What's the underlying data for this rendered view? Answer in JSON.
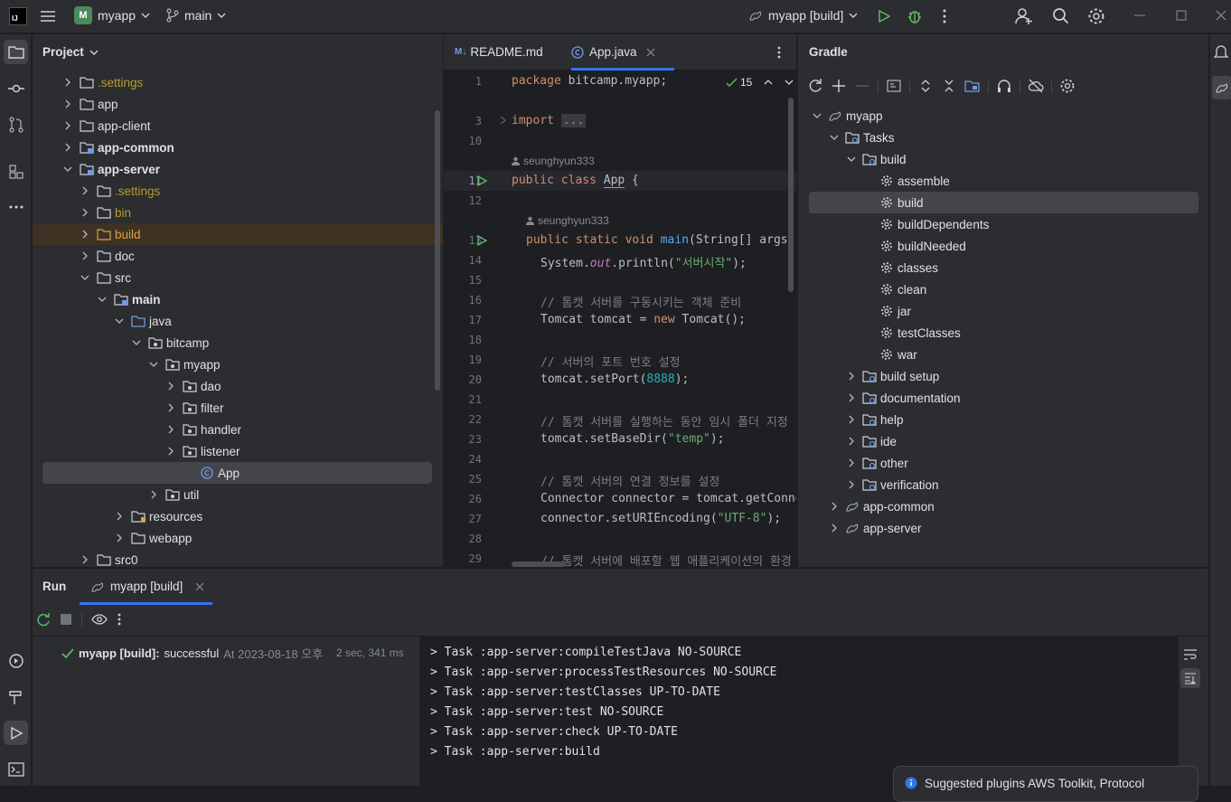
{
  "titlebar": {
    "project_badge": "M",
    "project_name": "myapp",
    "branch": "main",
    "run_config": "myapp [build]"
  },
  "project": {
    "title": "Project",
    "items": [
      {
        "label": ".settings",
        "depth": 1,
        "color": "#b89c2e",
        "icon": "folder"
      },
      {
        "label": "app",
        "depth": 1,
        "color": "#dfe1e5",
        "icon": "folder"
      },
      {
        "label": "app-client",
        "depth": 1,
        "color": "#dfe1e5",
        "icon": "folder"
      },
      {
        "label": "app-common",
        "depth": 1,
        "color": "#dfe1e5",
        "icon": "module",
        "bold": true
      },
      {
        "label": "app-server",
        "depth": 1,
        "color": "#dfe1e5",
        "icon": "module",
        "bold": true,
        "open": true
      },
      {
        "label": ".settings",
        "depth": 2,
        "color": "#b89c2e",
        "icon": "folder"
      },
      {
        "label": "bin",
        "depth": 2,
        "color": "#b89c2e",
        "icon": "folder"
      },
      {
        "label": "build",
        "depth": 2,
        "color": "#d9a343",
        "icon": "folder-orange",
        "highlight": true
      },
      {
        "label": "doc",
        "depth": 2,
        "color": "#dfe1e5",
        "icon": "folder"
      },
      {
        "label": "src",
        "depth": 2,
        "color": "#dfe1e5",
        "icon": "folder",
        "open": true
      },
      {
        "label": "main",
        "depth": 3,
        "color": "#dfe1e5",
        "icon": "module",
        "bold": true,
        "open": true
      },
      {
        "label": "java",
        "depth": 4,
        "color": "#dfe1e5",
        "icon": "folder-blue",
        "open": true
      },
      {
        "label": "bitcamp",
        "depth": 5,
        "color": "#dfe1e5",
        "icon": "package",
        "open": true
      },
      {
        "label": "myapp",
        "depth": 6,
        "color": "#dfe1e5",
        "icon": "package",
        "open": true
      },
      {
        "label": "dao",
        "depth": 7,
        "color": "#dfe1e5",
        "icon": "package"
      },
      {
        "label": "filter",
        "depth": 7,
        "color": "#dfe1e5",
        "icon": "package"
      },
      {
        "label": "handler",
        "depth": 7,
        "color": "#dfe1e5",
        "icon": "package"
      },
      {
        "label": "listener",
        "depth": 7,
        "color": "#dfe1e5",
        "icon": "package"
      },
      {
        "label": "App",
        "depth": 8,
        "color": "#dfe1e5",
        "icon": "class",
        "selected": true,
        "leaf": true
      },
      {
        "label": "util",
        "depth": 6,
        "color": "#dfe1e5",
        "icon": "package"
      },
      {
        "label": "resources",
        "depth": 4,
        "color": "#dfe1e5",
        "icon": "folder-res"
      },
      {
        "label": "webapp",
        "depth": 4,
        "color": "#dfe1e5",
        "icon": "folder"
      },
      {
        "label": "src0",
        "depth": 2,
        "color": "#dfe1e5",
        "icon": "folder"
      }
    ]
  },
  "editor": {
    "tabs": [
      {
        "label": "README.md",
        "badge": "M↓"
      },
      {
        "label": "App.java",
        "active": true
      }
    ],
    "inspection_count": "15",
    "author1": "seunghyun333",
    "author2": "seunghyun333"
  },
  "gradle": {
    "title": "Gradle",
    "items": [
      {
        "label": "myapp",
        "depth": 0,
        "icon": "gradle",
        "arrow": "open"
      },
      {
        "label": "Tasks",
        "depth": 1,
        "icon": "folder-tasks",
        "arrow": "open"
      },
      {
        "label": "build",
        "depth": 2,
        "icon": "folder-tasks",
        "arrow": "open"
      },
      {
        "label": "assemble",
        "depth": 3,
        "icon": "gear"
      },
      {
        "label": "build",
        "depth": 3,
        "icon": "gear",
        "selected": true
      },
      {
        "label": "buildDependents",
        "depth": 3,
        "icon": "gear"
      },
      {
        "label": "buildNeeded",
        "depth": 3,
        "icon": "gear"
      },
      {
        "label": "classes",
        "depth": 3,
        "icon": "gear"
      },
      {
        "label": "clean",
        "depth": 3,
        "icon": "gear"
      },
      {
        "label": "jar",
        "depth": 3,
        "icon": "gear"
      },
      {
        "label": "testClasses",
        "depth": 3,
        "icon": "gear"
      },
      {
        "label": "war",
        "depth": 3,
        "icon": "gear"
      },
      {
        "label": "build setup",
        "depth": 2,
        "icon": "folder-tasks",
        "arrow": "closed"
      },
      {
        "label": "documentation",
        "depth": 2,
        "icon": "folder-tasks",
        "arrow": "closed"
      },
      {
        "label": "help",
        "depth": 2,
        "icon": "folder-tasks",
        "arrow": "closed"
      },
      {
        "label": "ide",
        "depth": 2,
        "icon": "folder-tasks",
        "arrow": "closed"
      },
      {
        "label": "other",
        "depth": 2,
        "icon": "folder-tasks",
        "arrow": "closed"
      },
      {
        "label": "verification",
        "depth": 2,
        "icon": "folder-tasks",
        "arrow": "closed"
      },
      {
        "label": "app-common",
        "depth": 1,
        "icon": "gradle",
        "arrow": "closed"
      },
      {
        "label": "app-server",
        "depth": 1,
        "icon": "gradle",
        "arrow": "closed"
      }
    ]
  },
  "run": {
    "title": "Run",
    "tab": "myapp [build]",
    "result_name": "myapp [build]:",
    "result_status": "successful",
    "result_time": "At 2023-08-18 오후",
    "duration": "2 sec, 341 ms",
    "console": [
      "> Task :app-server:compileTestJava NO-SOURCE",
      "> Task :app-server:processTestResources NO-SOURCE",
      "> Task :app-server:testClasses UP-TO-DATE",
      "> Task :app-server:test NO-SOURCE",
      "> Task :app-server:check UP-TO-DATE",
      "> Task :app-server:build"
    ]
  },
  "notification": {
    "text": "Suggested plugins AWS Toolkit, Protocol"
  }
}
